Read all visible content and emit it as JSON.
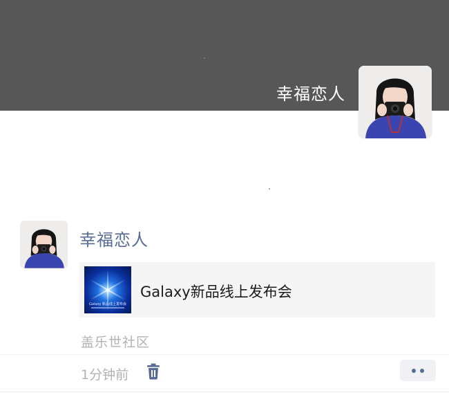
{
  "profile": {
    "cover_color": "#575757",
    "name": "幸福恋人",
    "avatar_icon": "avatar-photo-girl-with-camera"
  },
  "post": {
    "author": "幸福恋人",
    "author_color": "#576b95",
    "avatar_icon": "avatar-photo-girl-with-camera",
    "link": {
      "title": "Galaxy新品线上发布会",
      "thumbnail_icon": "galaxy-event-thumbnail",
      "thumbnail_caption": "Galaxy 新品线上发布会"
    },
    "source": "盖乐世社区",
    "time": "1分钟前",
    "delete_icon": "trash-icon",
    "more_icon": "more-dots-icon"
  }
}
